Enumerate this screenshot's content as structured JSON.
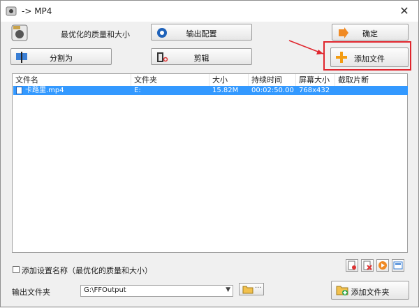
{
  "window": {
    "title": "-> MP4",
    "close_glyph": "✕"
  },
  "quality": {
    "label": "最优化的质量和大小"
  },
  "buttons": {
    "output_config": "输出配置",
    "confirm": "确定",
    "split": "分割为",
    "clip": "剪辑",
    "add_file": "添加文件",
    "add_folder": "添加文件夹"
  },
  "table": {
    "columns": [
      "文件名",
      "文件夹",
      "大小",
      "持续时间",
      "屏幕大小",
      "截取片断"
    ],
    "rows": [
      {
        "name": "卡路里.mp4",
        "folder": "E:",
        "size": "15.82M",
        "duration": "00:02:50.00",
        "screen": "768x432",
        "clip": ""
      }
    ]
  },
  "options": {
    "add_setting_name": "添加设置名称（最优化的质量和大小）"
  },
  "output": {
    "label": "输出文件夹",
    "path": "G:\\FFOutput",
    "browse_dots": "···"
  },
  "colors": {
    "selection": "#3399ff",
    "highlight_box": "#e0262e",
    "accent_orange": "#f39c12"
  },
  "icons": [
    "app-icon",
    "quality-icon",
    "gear-icon",
    "arrow-right-icon",
    "split-icon",
    "film-scissors-icon",
    "plus-icon",
    "folder-plus-icon",
    "remove-icon",
    "clear-icon",
    "play-icon",
    "info-icon",
    "folder-icon"
  ]
}
